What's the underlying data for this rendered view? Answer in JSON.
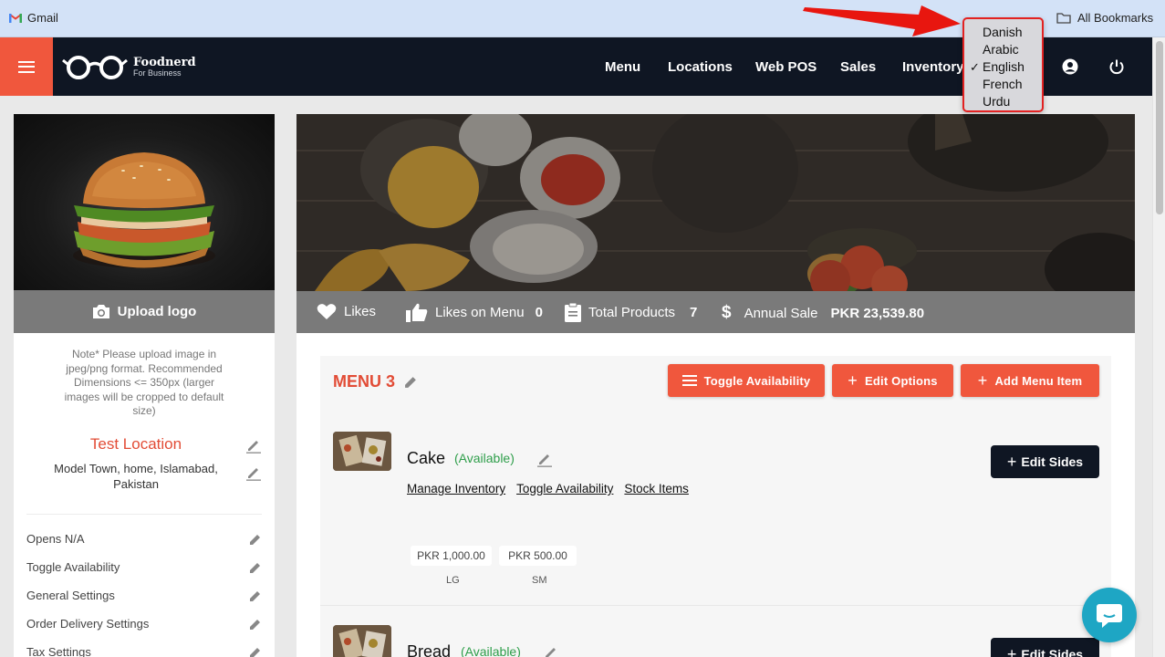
{
  "bookmarks_bar": {
    "gmail_label": "Gmail",
    "all_bookmarks_label": "All Bookmarks"
  },
  "header": {
    "brand_name": "Foodnerd",
    "brand_tagline": "For Business",
    "nav": [
      "Menu",
      "Locations",
      "Web POS",
      "Sales",
      "Inventory"
    ]
  },
  "language_menu": {
    "options": [
      "Danish",
      "Arabic",
      "English",
      "French",
      "Urdu"
    ],
    "selected": "English",
    "check_mark": "✓"
  },
  "left_panel": {
    "upload_label": "Upload logo",
    "note": "Note* Please upload image in jpeg/png format. Recommended Dimensions <= 350px (larger images will be cropped to default size)",
    "location_name": "Test Location",
    "location_address": "Model Town, home, Islamabad, Pakistan",
    "settings": [
      "Opens N/A",
      "Toggle Availability",
      "General Settings",
      "Order Delivery Settings",
      "Tax Settings"
    ]
  },
  "stats": {
    "likes_label": "Likes",
    "likes_on_menu_label": "Likes on Menu",
    "likes_on_menu_value": "0",
    "total_products_label": "Total Products",
    "total_products_value": "7",
    "annual_sale_label": "Annual Sale",
    "annual_sale_value": "PKR 23,539.80"
  },
  "menu": {
    "title": "MENU 3",
    "toggle_availability_label": "Toggle Availability",
    "edit_options_label": "Edit Options",
    "add_menu_item_label": "Add Menu Item",
    "items": [
      {
        "name": "Cake",
        "availability": "(Available)",
        "links": [
          "Manage Inventory",
          "Toggle Availability",
          "Stock Items"
        ],
        "edit_sides_label": "Edit Sides",
        "prices": [
          {
            "price": "PKR 1,000.00",
            "size": "LG"
          },
          {
            "price": "PKR 500.00",
            "size": "SM"
          }
        ]
      },
      {
        "name": "Bread",
        "availability": "(Available)",
        "edit_sides_label": "Edit Sides"
      }
    ]
  },
  "colors": {
    "accent": "#f0573d",
    "header_bg": "#0f1623",
    "available_green": "#2e9e4a",
    "chat_blue": "#1ea6c4",
    "highlight_red": "#e32222"
  }
}
